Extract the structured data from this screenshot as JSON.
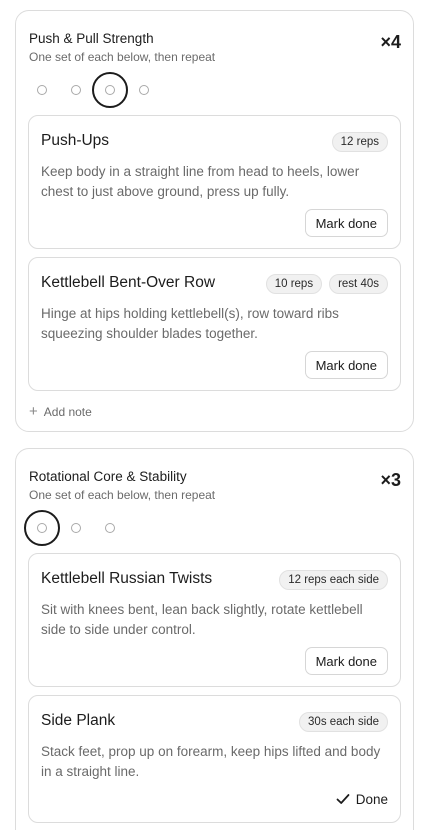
{
  "blocks": [
    {
      "title": "Push & Pull Strength",
      "subtitle": "One set of each below, then repeat",
      "rounds_label": "×4",
      "rounds_total": 4,
      "current_round": 3,
      "exercises": [
        {
          "name": "Push-Ups",
          "tags": [
            "12 reps"
          ],
          "description": "Keep body in a straight line from head to heels, lower chest to just above ground, press up fully.",
          "action_label": "Mark done",
          "done": false
        },
        {
          "name": "Kettlebell Bent-Over Row",
          "tags": [
            "10 reps",
            "rest 40s"
          ],
          "description": "Hinge at hips holding kettlebell(s), row toward ribs squeezing shoulder blades together.",
          "action_label": "Mark done",
          "done": false
        }
      ],
      "add_note_label": "Add note"
    },
    {
      "title": "Rotational Core & Stability",
      "subtitle": "One set of each below, then repeat",
      "rounds_label": "×3",
      "rounds_total": 3,
      "current_round": 1,
      "exercises": [
        {
          "name": "Kettlebell Russian Twists",
          "tags": [
            "12 reps each side"
          ],
          "description": "Sit with knees bent, lean back slightly, rotate kettlebell side to side under control.",
          "action_label": "Mark done",
          "done": false
        },
        {
          "name": "Side Plank",
          "tags": [
            "30s each side"
          ],
          "description": "Stack feet, prop up on forearm, keep hips lifted and body in a straight line.",
          "action_label": "Done",
          "done": true
        }
      ]
    }
  ],
  "icons": {
    "add_note": "plus-icon",
    "done": "checkmark-icon"
  }
}
